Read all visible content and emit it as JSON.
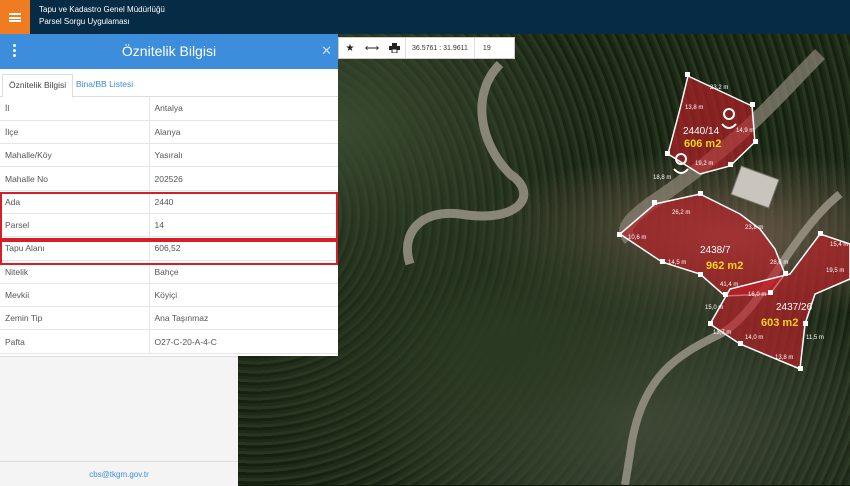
{
  "header": {
    "line1": "Tapu ve Kadastro Genel Müdürlüğü",
    "line2": "Parsel Sorgu Uygulaması",
    "menu_icon": "hamburger-icon"
  },
  "toolbar": {
    "coords": "36.5761 : 31.9611",
    "zoom": "19",
    "icons": [
      "star-icon",
      "measure-icon",
      "print-icon"
    ]
  },
  "panel": {
    "title": "Öznitelik Bilgisi",
    "tabs": [
      "Öznitelik Bilgisi",
      "Bina/BB Listesi"
    ],
    "rows": [
      {
        "k": "İl",
        "v": "Antalya"
      },
      {
        "k": "İlçe",
        "v": "Alanya"
      },
      {
        "k": "Mahalle/Köy",
        "v": "Yasıralı"
      },
      {
        "k": "Mahalle No",
        "v": "202526"
      },
      {
        "k": "Ada",
        "v": "2440"
      },
      {
        "k": "Parsel",
        "v": "14"
      },
      {
        "k": "Tapu Alanı",
        "v": "606,52"
      },
      {
        "k": "Nitelik",
        "v": "Bahçe"
      },
      {
        "k": "Mevkii",
        "v": "Köyiçi"
      },
      {
        "k": "Zemin Tip",
        "v": "Ana Taşınmaz"
      },
      {
        "k": "Pafta",
        "v": "O27-C-20-A-4-C"
      }
    ]
  },
  "footer": {
    "email": "cbs@tkgm.gov.tr"
  },
  "map": {
    "parcels": [
      {
        "id": "2440/14",
        "area": "606 m2"
      },
      {
        "id": "2438/7",
        "area": "962 m2"
      },
      {
        "id": "2437/26",
        "area": "603 m2"
      }
    ],
    "edge_labels": [
      "23,2 m",
      "13,8 m",
      "14,9 m",
      "19,2 m",
      "18,8 m",
      "26,2 m",
      "10,6 m",
      "14,5 m",
      "23,8 m",
      "28,6 m",
      "41,4 m",
      "15,4 m",
      "19,5 m",
      "11,5 m",
      "15,0 m",
      "13,7 m",
      "14,0 m",
      "13,8 m",
      "16,0 m"
    ]
  }
}
